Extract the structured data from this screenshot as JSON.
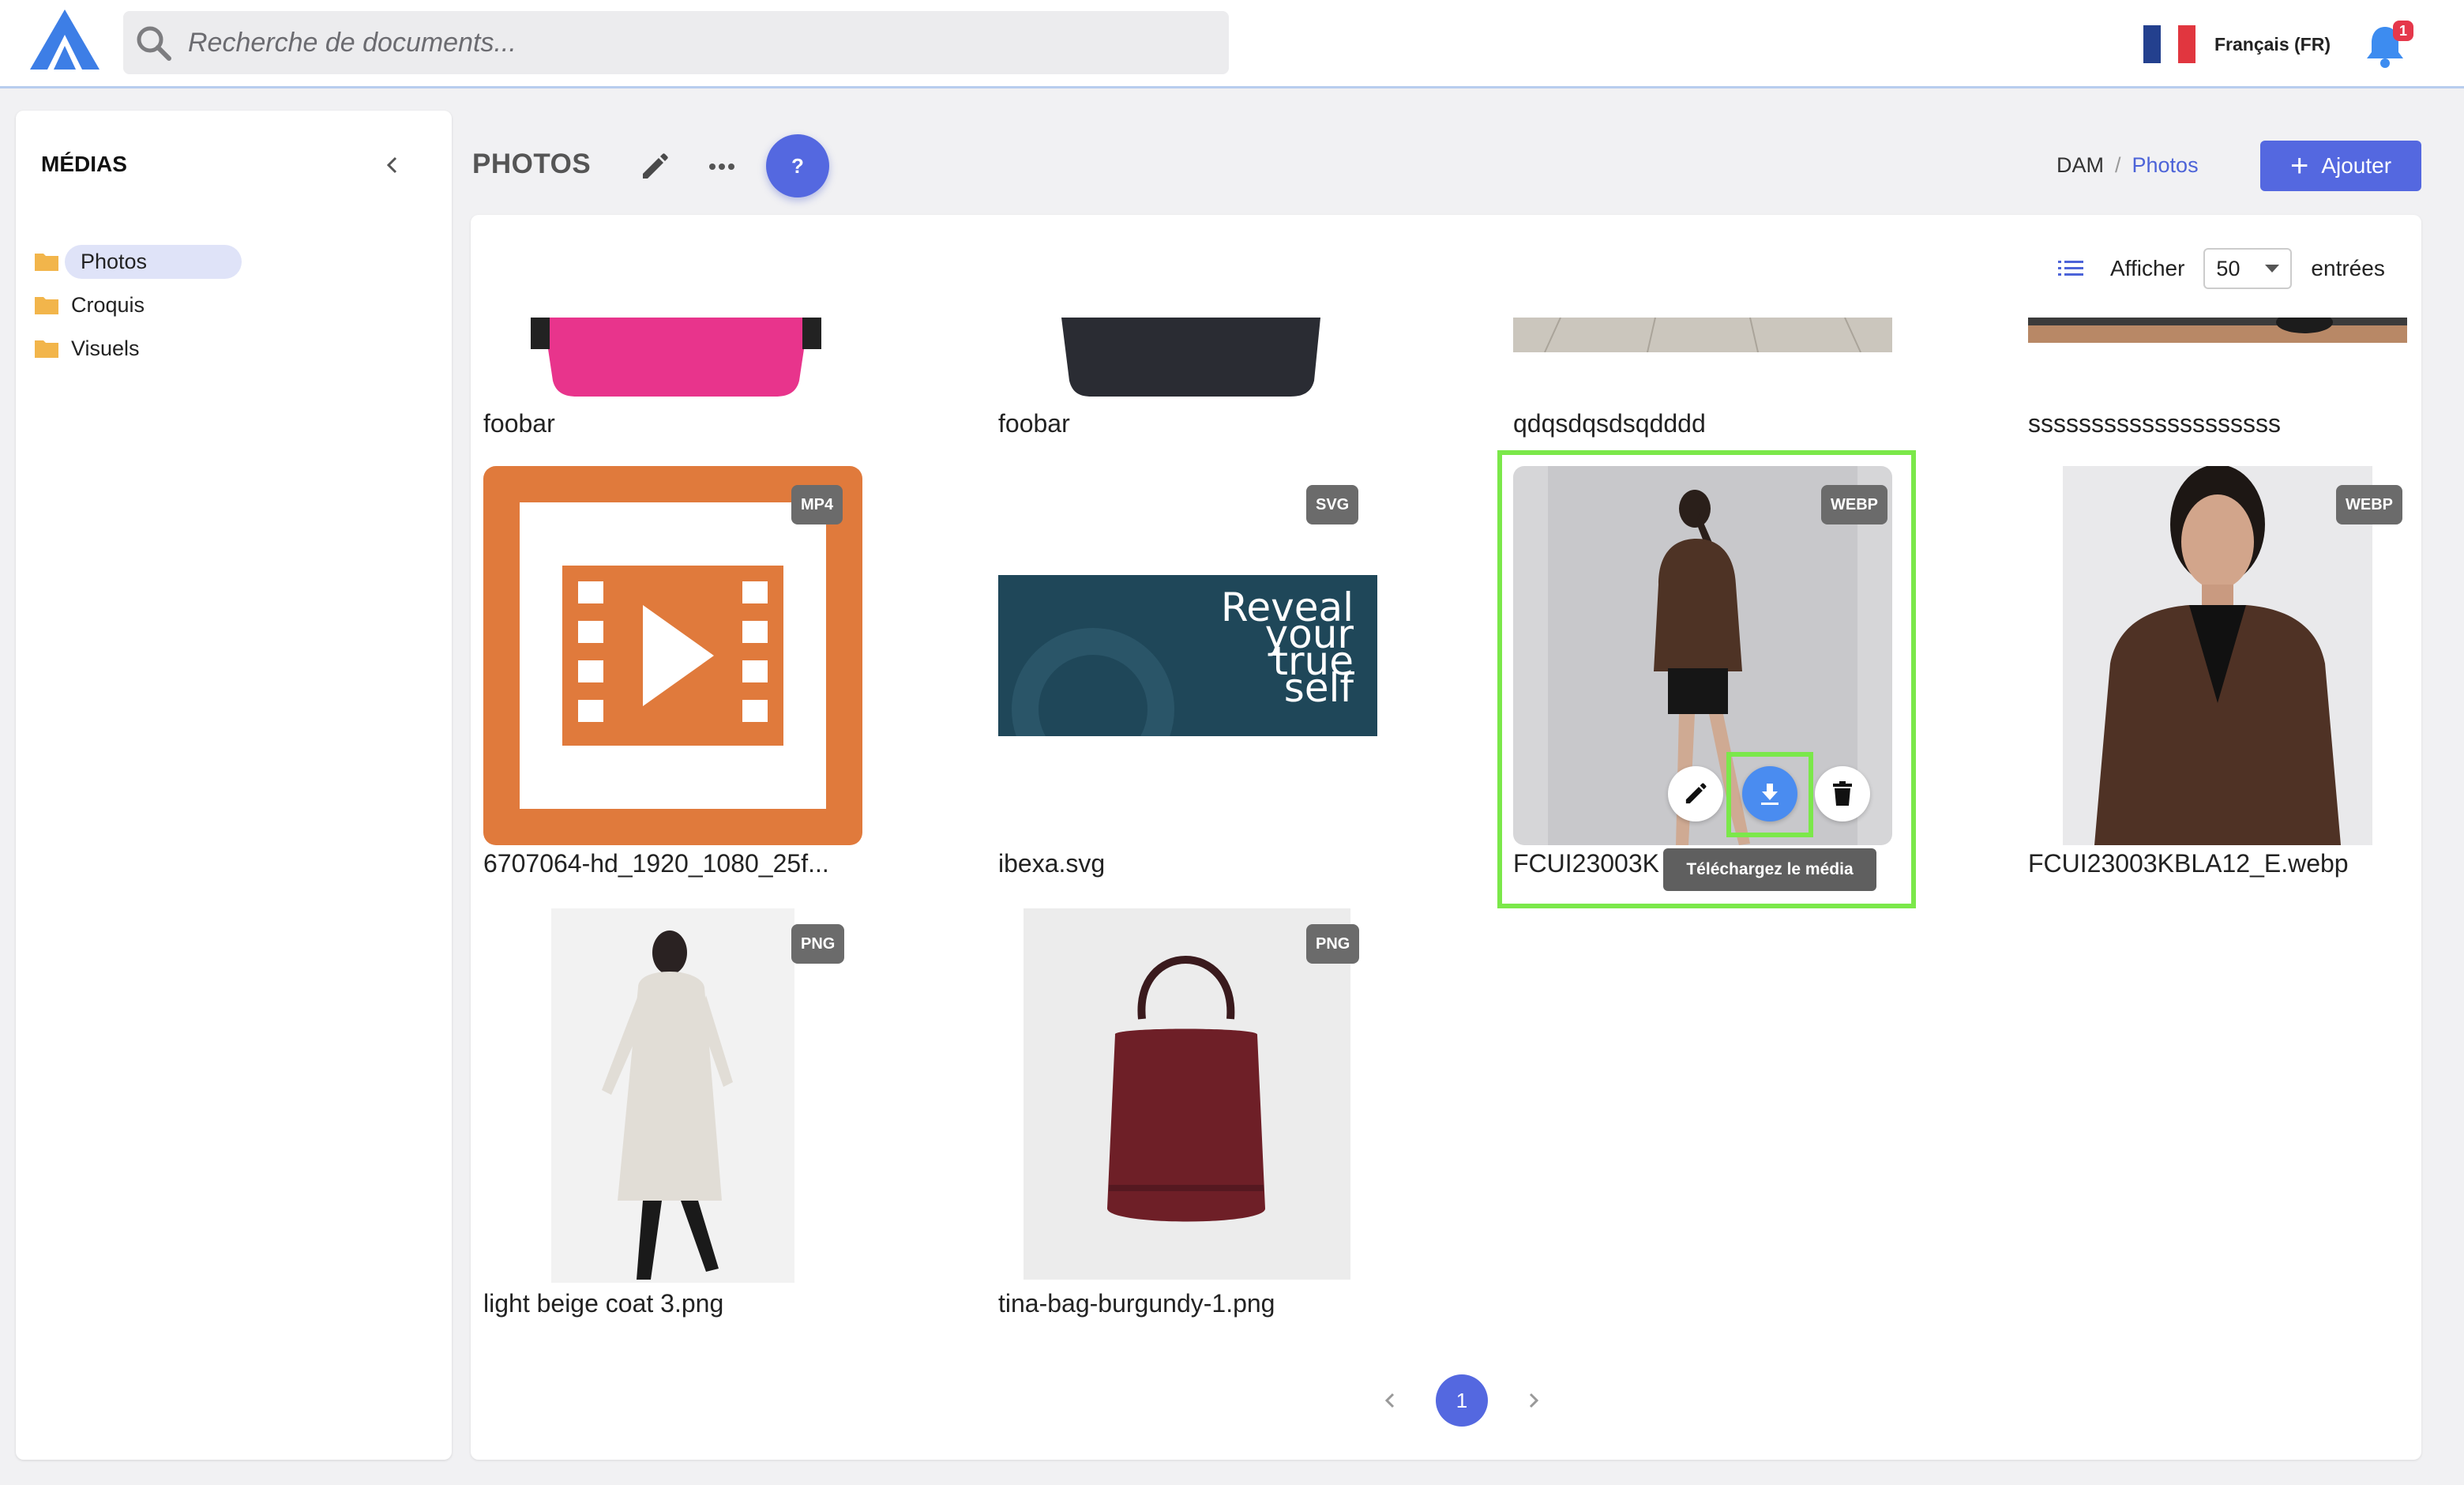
{
  "topbar": {
    "search_placeholder": "Recherche de documents...",
    "language": "Français (FR)",
    "notification_count": "1"
  },
  "sidebar": {
    "title": "MÉDIAS",
    "folders": [
      {
        "label": "Photos",
        "active": true
      },
      {
        "label": "Croquis",
        "active": false
      },
      {
        "label": "Visuels",
        "active": false
      }
    ]
  },
  "header": {
    "title": "PHOTOS",
    "help_label": "?",
    "breadcrumb": [
      "DAM",
      "Photos"
    ],
    "add_label": "Ajouter"
  },
  "listing": {
    "show_label": "Afficher",
    "page_size": "50",
    "entries_label": "entrées"
  },
  "media": [
    {
      "name": "foobar",
      "type": ""
    },
    {
      "name": "foobar",
      "type": ""
    },
    {
      "name": "qdqsdqsdsqdddd",
      "type": ""
    },
    {
      "name": "ssssssssssssssssssss",
      "type": ""
    },
    {
      "name": "6707064-hd_1920_1080_25f...",
      "type": "MP4"
    },
    {
      "name": "ibexa.svg",
      "type": "SVG",
      "svg_text": [
        "Reveal",
        "your",
        "true",
        "self"
      ]
    },
    {
      "name": "FCUI23003K",
      "type": "WEBP"
    },
    {
      "name": "FCUI23003KBLA12_E.webp",
      "type": "WEBP"
    },
    {
      "name": "light beige coat 3.png",
      "type": "PNG"
    },
    {
      "name": "tina-bag-burgundy-1.png",
      "type": "PNG"
    }
  ],
  "tooltip": "Téléchargez le média",
  "pagination": {
    "current": "1"
  },
  "colors": {
    "accent": "#5468e0",
    "highlight": "#7be84a",
    "download": "#4a8cf0"
  }
}
